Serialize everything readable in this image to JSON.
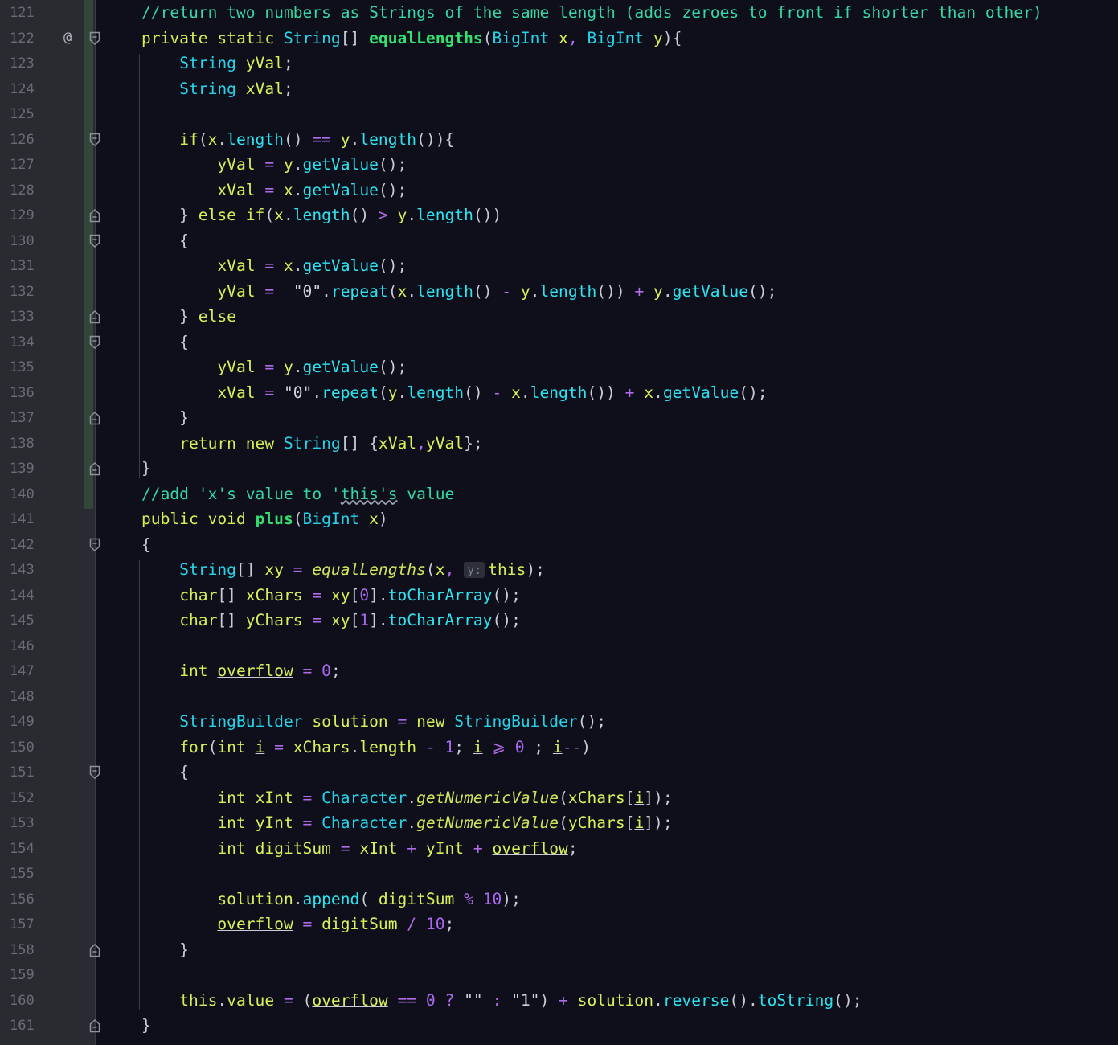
{
  "colors": {
    "background": "#0e0f1a",
    "gutter": "#2a2b30",
    "comment": "#35d7a2",
    "keyword": "#d4ee55",
    "type": "#27d3e8",
    "method_declaration": "#35e070",
    "operator": "#b06ce8",
    "number": "#a96af0",
    "line_number": "#6a6d78"
  },
  "gutter": {
    "annotation_icon": "@",
    "annotation_icon_name": "override-at-icon"
  },
  "inlay_hint": "y:",
  "lines": [
    {
      "n": "121",
      "fold": "",
      "tokens": [
        [
          "c",
          "//return two numbers as Strings of the same length (adds zeroes to front if shorter than other)"
        ]
      ]
    },
    {
      "n": "122",
      "fold": "open",
      "annot": true,
      "tokens": [
        [
          "k",
          "private static "
        ],
        [
          "t",
          "String"
        ],
        [
          "p",
          "[] "
        ],
        [
          "md",
          "equalLengths"
        ],
        [
          "p",
          "("
        ],
        [
          "t",
          "BigInt"
        ],
        [
          "id",
          " x"
        ],
        [
          "op",
          ", "
        ],
        [
          "t",
          "BigInt"
        ],
        [
          "id",
          " y"
        ],
        [
          "p",
          "){"
        ]
      ]
    },
    {
      "n": "123",
      "fold": "",
      "tokens": [
        [
          "p",
          "    "
        ],
        [
          "t",
          "String"
        ],
        [
          "id",
          " yVal"
        ],
        [
          "p",
          ";"
        ]
      ]
    },
    {
      "n": "124",
      "fold": "",
      "tokens": [
        [
          "p",
          "    "
        ],
        [
          "t",
          "String"
        ],
        [
          "id",
          " xVal"
        ],
        [
          "p",
          ";"
        ]
      ]
    },
    {
      "n": "125",
      "fold": "",
      "tokens": []
    },
    {
      "n": "126",
      "fold": "open",
      "tokens": [
        [
          "p",
          "    "
        ],
        [
          "k",
          "if"
        ],
        [
          "p",
          "("
        ],
        [
          "id",
          "x"
        ],
        [
          "p",
          "."
        ],
        [
          "m",
          "length"
        ],
        [
          "p",
          "() "
        ],
        [
          "op",
          "=="
        ],
        [
          "id",
          " y"
        ],
        [
          "p",
          "."
        ],
        [
          "m",
          "length"
        ],
        [
          "p",
          "()){"
        ]
      ]
    },
    {
      "n": "127",
      "fold": "",
      "tokens": [
        [
          "p",
          "        "
        ],
        [
          "id",
          "yVal"
        ],
        [
          "op",
          " = "
        ],
        [
          "id",
          "y"
        ],
        [
          "p",
          "."
        ],
        [
          "m",
          "getValue"
        ],
        [
          "p",
          "();"
        ]
      ]
    },
    {
      "n": "128",
      "fold": "",
      "tokens": [
        [
          "p",
          "        "
        ],
        [
          "id",
          "xVal"
        ],
        [
          "op",
          " = "
        ],
        [
          "id",
          "x"
        ],
        [
          "p",
          "."
        ],
        [
          "m",
          "getValue"
        ],
        [
          "p",
          "();"
        ]
      ]
    },
    {
      "n": "129",
      "fold": "close",
      "tokens": [
        [
          "p",
          "    } "
        ],
        [
          "k",
          "else if"
        ],
        [
          "p",
          "("
        ],
        [
          "id",
          "x"
        ],
        [
          "p",
          "."
        ],
        [
          "m",
          "length"
        ],
        [
          "p",
          "() "
        ],
        [
          "op",
          ">"
        ],
        [
          "id",
          " y"
        ],
        [
          "p",
          "."
        ],
        [
          "m",
          "length"
        ],
        [
          "p",
          "())"
        ]
      ]
    },
    {
      "n": "130",
      "fold": "open",
      "tokens": [
        [
          "p",
          "    {"
        ]
      ]
    },
    {
      "n": "131",
      "fold": "",
      "tokens": [
        [
          "p",
          "        "
        ],
        [
          "id",
          "xVal"
        ],
        [
          "op",
          " = "
        ],
        [
          "id",
          "x"
        ],
        [
          "p",
          "."
        ],
        [
          "m",
          "getValue"
        ],
        [
          "p",
          "();"
        ]
      ]
    },
    {
      "n": "132",
      "fold": "",
      "tokens": [
        [
          "p",
          "        "
        ],
        [
          "id",
          "yVal"
        ],
        [
          "op",
          " =  "
        ],
        [
          "s",
          "\"0\""
        ],
        [
          "p",
          "."
        ],
        [
          "m",
          "repeat"
        ],
        [
          "p",
          "("
        ],
        [
          "id",
          "x"
        ],
        [
          "p",
          "."
        ],
        [
          "m",
          "length"
        ],
        [
          "p",
          "() "
        ],
        [
          "op",
          "-"
        ],
        [
          "id",
          " y"
        ],
        [
          "p",
          "."
        ],
        [
          "m",
          "length"
        ],
        [
          "p",
          "()) "
        ],
        [
          "op",
          "+"
        ],
        [
          "id",
          " y"
        ],
        [
          "p",
          "."
        ],
        [
          "m",
          "getValue"
        ],
        [
          "p",
          "();"
        ]
      ]
    },
    {
      "n": "133",
      "fold": "close",
      "tokens": [
        [
          "p",
          "    } "
        ],
        [
          "k",
          "else"
        ]
      ]
    },
    {
      "n": "134",
      "fold": "open",
      "tokens": [
        [
          "p",
          "    {"
        ]
      ]
    },
    {
      "n": "135",
      "fold": "",
      "tokens": [
        [
          "p",
          "        "
        ],
        [
          "id",
          "yVal"
        ],
        [
          "op",
          " = "
        ],
        [
          "id",
          "y"
        ],
        [
          "p",
          "."
        ],
        [
          "m",
          "getValue"
        ],
        [
          "p",
          "();"
        ]
      ]
    },
    {
      "n": "136",
      "fold": "",
      "tokens": [
        [
          "p",
          "        "
        ],
        [
          "id",
          "xVal"
        ],
        [
          "op",
          " = "
        ],
        [
          "s",
          "\"0\""
        ],
        [
          "p",
          "."
        ],
        [
          "m",
          "repeat"
        ],
        [
          "p",
          "("
        ],
        [
          "id",
          "y"
        ],
        [
          "p",
          "."
        ],
        [
          "m",
          "length"
        ],
        [
          "p",
          "() "
        ],
        [
          "op",
          "-"
        ],
        [
          "id",
          " x"
        ],
        [
          "p",
          "."
        ],
        [
          "m",
          "length"
        ],
        [
          "p",
          "()) "
        ],
        [
          "op",
          "+"
        ],
        [
          "id",
          " x"
        ],
        [
          "p",
          "."
        ],
        [
          "m",
          "getValue"
        ],
        [
          "p",
          "();"
        ]
      ]
    },
    {
      "n": "137",
      "fold": "close",
      "tokens": [
        [
          "p",
          "    }"
        ]
      ]
    },
    {
      "n": "138",
      "fold": "",
      "tokens": [
        [
          "p",
          "    "
        ],
        [
          "k",
          "return new "
        ],
        [
          "t",
          "String"
        ],
        [
          "p",
          "[] {"
        ],
        [
          "id",
          "xVal"
        ],
        [
          "op",
          ","
        ],
        [
          "id",
          "yVal"
        ],
        [
          "p",
          "};"
        ]
      ]
    },
    {
      "n": "139",
      "fold": "close",
      "tokens": [
        [
          "p",
          "}"
        ]
      ]
    },
    {
      "n": "140",
      "fold": "",
      "tokens": [
        [
          "c",
          "//add 'x's value to '"
        ],
        [
          "csq",
          "this's"
        ],
        [
          "c",
          " value"
        ]
      ]
    },
    {
      "n": "141",
      "fold": "",
      "tokens": [
        [
          "k",
          "public void "
        ],
        [
          "md",
          "plus"
        ],
        [
          "p",
          "("
        ],
        [
          "t",
          "BigInt"
        ],
        [
          "id",
          " x"
        ],
        [
          "p",
          ")"
        ]
      ]
    },
    {
      "n": "142",
      "fold": "open",
      "tokens": [
        [
          "p",
          "{"
        ]
      ]
    },
    {
      "n": "143",
      "fold": "",
      "tokens": [
        [
          "p",
          "    "
        ],
        [
          "t",
          "String"
        ],
        [
          "p",
          "[] "
        ],
        [
          "id",
          "xy"
        ],
        [
          "op",
          " = "
        ],
        [
          "it",
          "equalLengths"
        ],
        [
          "p",
          "("
        ],
        [
          "id",
          "x"
        ],
        [
          "op",
          ", "
        ],
        [
          "hint",
          "y:"
        ],
        [
          "k",
          "this"
        ],
        [
          "p",
          ");"
        ]
      ]
    },
    {
      "n": "144",
      "fold": "",
      "tokens": [
        [
          "p",
          "    "
        ],
        [
          "k",
          "char"
        ],
        [
          "p",
          "[] "
        ],
        [
          "id",
          "xChars"
        ],
        [
          "op",
          " = "
        ],
        [
          "id",
          "xy"
        ],
        [
          "p",
          "["
        ],
        [
          "n",
          "0"
        ],
        [
          "p",
          "]."
        ],
        [
          "m",
          "toCharArray"
        ],
        [
          "p",
          "();"
        ]
      ]
    },
    {
      "n": "145",
      "fold": "",
      "tokens": [
        [
          "p",
          "    "
        ],
        [
          "k",
          "char"
        ],
        [
          "p",
          "[] "
        ],
        [
          "id",
          "yChars"
        ],
        [
          "op",
          " = "
        ],
        [
          "id",
          "xy"
        ],
        [
          "p",
          "["
        ],
        [
          "n",
          "1"
        ],
        [
          "p",
          "]."
        ],
        [
          "m",
          "toCharArray"
        ],
        [
          "p",
          "();"
        ]
      ]
    },
    {
      "n": "146",
      "fold": "",
      "tokens": []
    },
    {
      "n": "147",
      "fold": "",
      "tokens": [
        [
          "p",
          "    "
        ],
        [
          "k",
          "int "
        ],
        [
          "idu",
          "overflow"
        ],
        [
          "op",
          " = "
        ],
        [
          "n",
          "0"
        ],
        [
          "p",
          ";"
        ]
      ]
    },
    {
      "n": "148",
      "fold": "",
      "tokens": []
    },
    {
      "n": "149",
      "fold": "",
      "tokens": [
        [
          "p",
          "    "
        ],
        [
          "t",
          "StringBuilder"
        ],
        [
          "id",
          " solution"
        ],
        [
          "op",
          " = "
        ],
        [
          "k",
          "new "
        ],
        [
          "t",
          "StringBuilder"
        ],
        [
          "p",
          "();"
        ]
      ]
    },
    {
      "n": "150",
      "fold": "",
      "tokens": [
        [
          "p",
          "    "
        ],
        [
          "k",
          "for"
        ],
        [
          "p",
          "("
        ],
        [
          "k",
          "int "
        ],
        [
          "idu",
          "i"
        ],
        [
          "op",
          " = "
        ],
        [
          "id",
          "xChars"
        ],
        [
          "p",
          "."
        ],
        [
          "id",
          "length"
        ],
        [
          "op",
          " - "
        ],
        [
          "n",
          "1"
        ],
        [
          "p",
          "; "
        ],
        [
          "idu",
          "i"
        ],
        [
          "op",
          " ⩾ "
        ],
        [
          "n",
          "0"
        ],
        [
          "p",
          " ; "
        ],
        [
          "idu",
          "i"
        ],
        [
          "op",
          "--"
        ],
        [
          "p",
          ")"
        ]
      ]
    },
    {
      "n": "151",
      "fold": "open",
      "tokens": [
        [
          "p",
          "    {"
        ]
      ]
    },
    {
      "n": "152",
      "fold": "",
      "tokens": [
        [
          "p",
          "        "
        ],
        [
          "k",
          "int "
        ],
        [
          "id",
          "xInt"
        ],
        [
          "op",
          " = "
        ],
        [
          "t",
          "Character"
        ],
        [
          "p",
          "."
        ],
        [
          "it",
          "getNumericValue"
        ],
        [
          "p",
          "("
        ],
        [
          "id",
          "xChars"
        ],
        [
          "p",
          "["
        ],
        [
          "idu",
          "i"
        ],
        [
          "p",
          "]);"
        ]
      ]
    },
    {
      "n": "153",
      "fold": "",
      "tokens": [
        [
          "p",
          "        "
        ],
        [
          "k",
          "int "
        ],
        [
          "id",
          "yInt"
        ],
        [
          "op",
          " = "
        ],
        [
          "t",
          "Character"
        ],
        [
          "p",
          "."
        ],
        [
          "it",
          "getNumericValue"
        ],
        [
          "p",
          "("
        ],
        [
          "id",
          "yChars"
        ],
        [
          "p",
          "["
        ],
        [
          "idu",
          "i"
        ],
        [
          "p",
          "]);"
        ]
      ]
    },
    {
      "n": "154",
      "fold": "",
      "tokens": [
        [
          "p",
          "        "
        ],
        [
          "k",
          "int "
        ],
        [
          "id",
          "digitSum"
        ],
        [
          "op",
          " = "
        ],
        [
          "id",
          "xInt"
        ],
        [
          "op",
          " + "
        ],
        [
          "id",
          "yInt"
        ],
        [
          "op",
          " + "
        ],
        [
          "idu",
          "overflow"
        ],
        [
          "p",
          ";"
        ]
      ]
    },
    {
      "n": "155",
      "fold": "",
      "tokens": []
    },
    {
      "n": "156",
      "fold": "",
      "tokens": [
        [
          "p",
          "        "
        ],
        [
          "id",
          "solution"
        ],
        [
          "p",
          "."
        ],
        [
          "m",
          "append"
        ],
        [
          "p",
          "( "
        ],
        [
          "id",
          "digitSum"
        ],
        [
          "op",
          " % "
        ],
        [
          "n",
          "10"
        ],
        [
          "p",
          ");"
        ]
      ]
    },
    {
      "n": "157",
      "fold": "",
      "tokens": [
        [
          "p",
          "        "
        ],
        [
          "idu",
          "overflow"
        ],
        [
          "op",
          " = "
        ],
        [
          "id",
          "digitSum"
        ],
        [
          "op",
          " / "
        ],
        [
          "n",
          "10"
        ],
        [
          "p",
          ";"
        ]
      ]
    },
    {
      "n": "158",
      "fold": "close",
      "tokens": [
        [
          "p",
          "    }"
        ]
      ]
    },
    {
      "n": "159",
      "fold": "",
      "tokens": []
    },
    {
      "n": "160",
      "fold": "",
      "tokens": [
        [
          "p",
          "    "
        ],
        [
          "k",
          "this"
        ],
        [
          "p",
          "."
        ],
        [
          "id",
          "value"
        ],
        [
          "op",
          " = "
        ],
        [
          "p",
          "("
        ],
        [
          "idu",
          "overflow"
        ],
        [
          "op",
          " == "
        ],
        [
          "n",
          "0"
        ],
        [
          "op",
          " ? "
        ],
        [
          "s",
          "\"\""
        ],
        [
          "op",
          " : "
        ],
        [
          "s",
          "\"1\""
        ],
        [
          "p",
          ") "
        ],
        [
          "op",
          "+"
        ],
        [
          "id",
          " solution"
        ],
        [
          "p",
          "."
        ],
        [
          "m",
          "reverse"
        ],
        [
          "p",
          "()."
        ],
        [
          "m",
          "toString"
        ],
        [
          "p",
          "();"
        ]
      ]
    },
    {
      "n": "161",
      "fold": "close",
      "tokens": [
        [
          "p",
          "}"
        ]
      ]
    }
  ]
}
